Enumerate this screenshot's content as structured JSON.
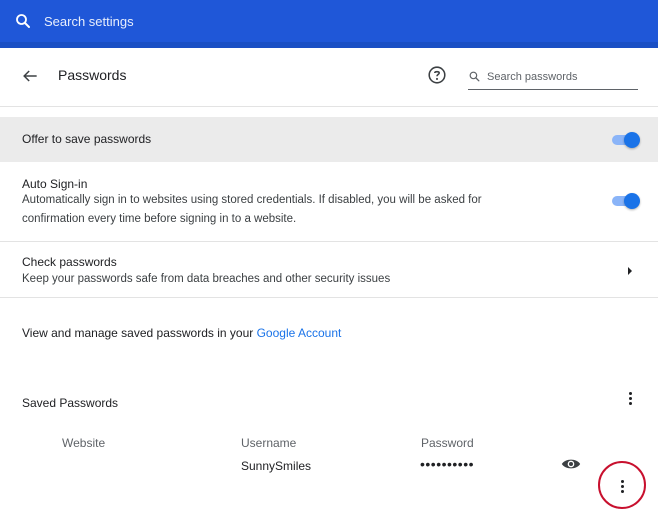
{
  "topbar": {
    "search_placeholder": "Search settings",
    "background": "#1f57d8"
  },
  "header": {
    "title": "Passwords",
    "back_icon": "arrow-left-icon",
    "help_icon": "help-circle-icon",
    "search_placeholder": "Search passwords"
  },
  "offer_to_save": {
    "label": "Offer to save passwords",
    "enabled": true
  },
  "auto_signin": {
    "label": "Auto Sign-in",
    "description_line1": "Automatically sign in to websites using stored credentials. If disabled, you will be asked for",
    "description_line2": "confirmation every time before signing in to a website.",
    "enabled": true
  },
  "check_passwords": {
    "label": "Check passwords",
    "description": "Keep your passwords safe from data breaches and other security issues"
  },
  "manage": {
    "text": "View and manage saved passwords in your ",
    "link": "Google Account"
  },
  "saved_passwords": {
    "title": "Saved Passwords",
    "columns": [
      "Website",
      "Username",
      "Password"
    ],
    "rows": [
      {
        "website": "",
        "username": "SunnySmiles",
        "password_masked": "••••••••••"
      }
    ]
  },
  "colors": {
    "accent": "#1a73e8",
    "toggle_track": "#8ab4f8",
    "highlight": "#c8102e"
  }
}
